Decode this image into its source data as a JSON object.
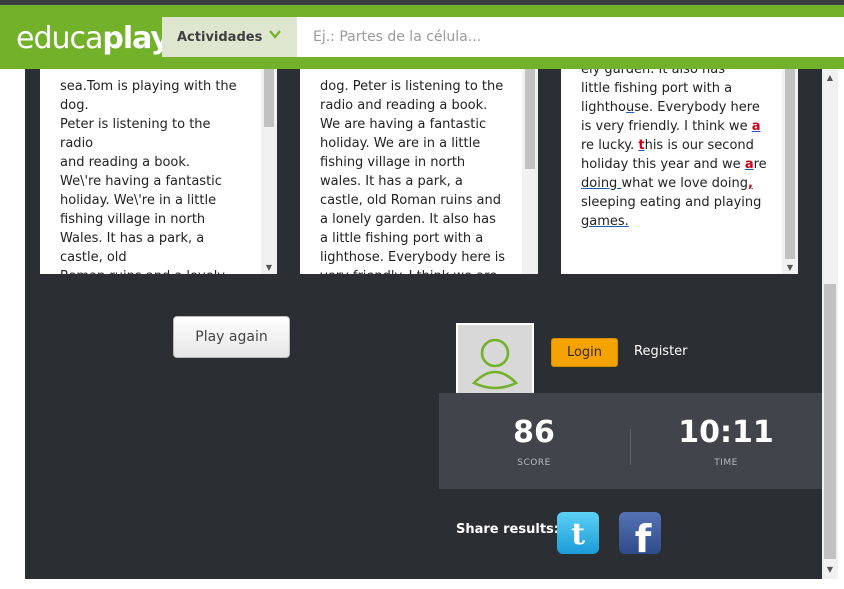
{
  "header": {
    "logo_light": "educa",
    "logo_bold": "play",
    "activities_label": "Actividades",
    "search_placeholder": "Ej.: Partes de la célula..."
  },
  "texts": {
    "original": "sea.Tom is playing with the\ndog.\nPeter is listening to the\nradio\nand reading a book.\nWe\\'re having a fantastic\nholiday. We\\'re in a little\nfishing village in north\nWales. It has a park, a\ncastle, old\nRoman ruins and a lovely",
    "answer": "dog. Peter is listening to the\nradio and reading a book.\nWe are having a fantastic\nholiday. We are in a little\nfishing village in north\nwales. It has a park, a\ncastle, old Roman ruins and\na lonely garden. It also has\na little fishing port with a\nlighthose. Everybody here is\nvery friendly. I think we are"
  },
  "corrected": {
    "line1": "ely garden. It also has",
    "line2": "little fishing port with a",
    "line3a": "lightho",
    "line3b": "u",
    "line3c": "se. Everybody here",
    "line4a": "is very friendly. I think we ",
    "line4b": "a",
    "line5a": "re lucky. ",
    "line5b": "t",
    "line5c": "his is our second",
    "line6": "holiday this year and we ",
    "line6b": "a",
    "line6c": "re",
    "line7a": "doing ",
    "line7b": "what we love doing",
    "line7c": ",",
    "line8": "sleeping eating and playing",
    "line9": "games."
  },
  "actions": {
    "play_again": "Play again",
    "login": "Login",
    "register": "Register"
  },
  "results": {
    "score_value": "86",
    "score_label": "SCORE",
    "time_value": "10:11",
    "time_label": "TIME",
    "share_label": "Share results:"
  },
  "colors": {
    "header_green": "#73b12a",
    "panel_dark": "#2b2e33",
    "login_orange": "#f5a300",
    "error_red": "#d0021b"
  }
}
